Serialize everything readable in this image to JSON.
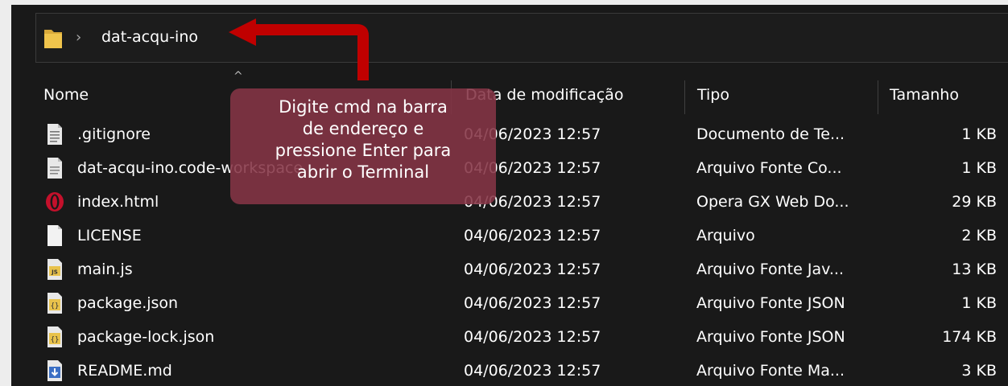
{
  "address_bar": {
    "breadcrumb_separator": "›",
    "path": "dat-acqu-ino"
  },
  "columns": {
    "name": "Nome",
    "date": "Data de modificação",
    "type": "Tipo",
    "size": "Tamanho",
    "sort_indicator": "^"
  },
  "files": [
    {
      "name": ".gitignore",
      "date": "04/06/2023 12:57",
      "type": "Documento de Te...",
      "size": "1 KB",
      "icon": "text-document-icon"
    },
    {
      "name": "dat-acqu-ino.code-workspace",
      "date": "04/06/2023 12:57",
      "type": "Arquivo Fonte Co...",
      "size": "1 KB",
      "icon": "generic-file-icon"
    },
    {
      "name": "index.html",
      "date": "04/06/2023 12:57",
      "type": "Opera GX Web Do...",
      "size": "29 KB",
      "icon": "opera-gx-icon"
    },
    {
      "name": "LICENSE",
      "date": "04/06/2023 12:57",
      "type": "Arquivo",
      "size": "2 KB",
      "icon": "blank-file-icon"
    },
    {
      "name": "main.js",
      "date": "04/06/2023 12:57",
      "type": "Arquivo Fonte Jav...",
      "size": "13 KB",
      "icon": "javascript-file-icon"
    },
    {
      "name": "package.json",
      "date": "04/06/2023 12:57",
      "type": "Arquivo Fonte JSON",
      "size": "1 KB",
      "icon": "json-file-icon"
    },
    {
      "name": "package-lock.json",
      "date": "04/06/2023 12:57",
      "type": "Arquivo Fonte JSON",
      "size": "174 KB",
      "icon": "json-file-icon"
    },
    {
      "name": "README.md",
      "date": "04/06/2023 12:57",
      "type": "Arquivo Fonte Ma...",
      "size": "3 KB",
      "icon": "markdown-file-icon"
    }
  ],
  "annotation": {
    "lines": [
      "Digite cmd na barra",
      "de endereço e",
      "pressione Enter para",
      "abrir o Terminal"
    ]
  },
  "colors": {
    "annotation_bg": "#853446",
    "arrow": "#c00000",
    "folder": "#f0c44c",
    "window_bg": "#191919"
  }
}
